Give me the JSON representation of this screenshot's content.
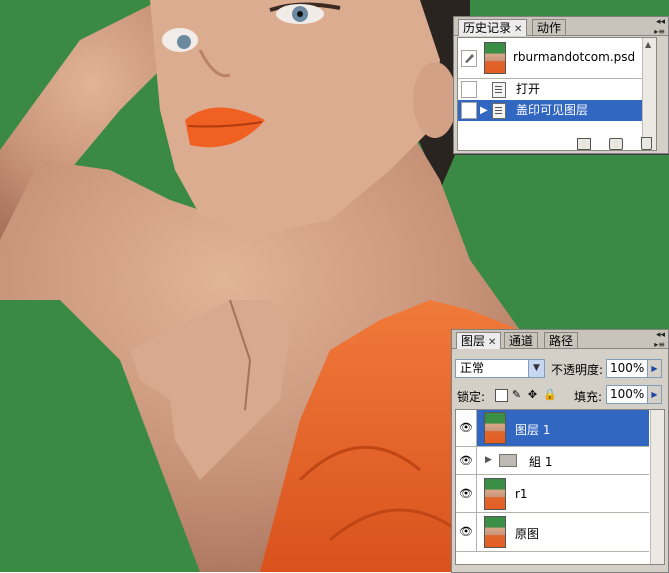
{
  "history_panel": {
    "tabs": [
      {
        "label": "历史记录",
        "active": true,
        "closable": true
      },
      {
        "label": "动作",
        "active": false,
        "closable": false
      }
    ],
    "snapshot": {
      "name": "rburmandotcom.psd"
    },
    "states": [
      {
        "label": "打开",
        "selected": false
      },
      {
        "label": "盖印可见图层",
        "selected": true
      }
    ],
    "footer_icons": [
      "new-document-from-state-icon",
      "camera-snapshot-icon",
      "trash-icon"
    ]
  },
  "layers_panel": {
    "tabs": [
      {
        "label": "图层",
        "active": true,
        "closable": true
      },
      {
        "label": "通道",
        "active": false,
        "closable": false
      },
      {
        "label": "路径",
        "active": false,
        "closable": false
      }
    ],
    "blend_mode": "正常",
    "opacity_label": "不透明度:",
    "opacity_value": "100%",
    "lock_label": "锁定:",
    "lock_icons": [
      "lock-transparent-pixels-icon",
      "lock-image-pixels-icon",
      "lock-position-icon",
      "lock-all-icon"
    ],
    "fill_label": "填充:",
    "fill_value": "100%",
    "layers": [
      {
        "name": "图层 1",
        "type": "image",
        "selected": true,
        "visible": true
      },
      {
        "name": "組 1",
        "type": "group",
        "selected": false,
        "visible": true
      },
      {
        "name": "r1",
        "type": "image",
        "selected": false,
        "visible": true
      },
      {
        "name": "原图",
        "type": "image",
        "selected": false,
        "visible": true
      }
    ]
  },
  "colors": {
    "selection": "#3166c1",
    "panel_bg": "#d4d0c8",
    "backdrop_green": "#3a8a45",
    "dress_orange": "#e5622a"
  }
}
